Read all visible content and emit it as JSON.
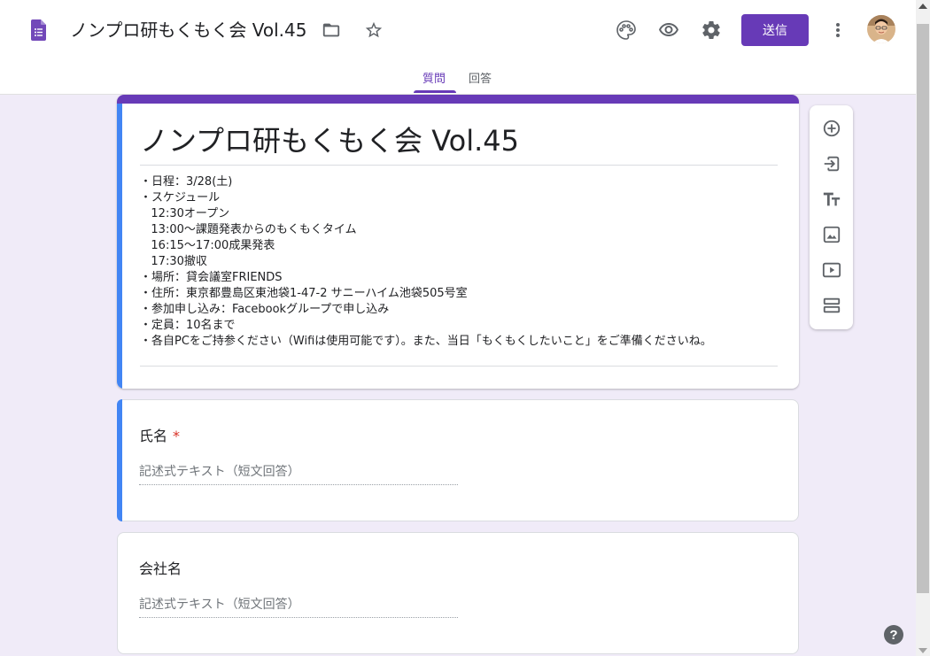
{
  "header": {
    "doc_title": "ノンプロ研もくもく会 Vol.45",
    "send_label": "送信",
    "icons": [
      "forms-logo-icon",
      "folder-icon",
      "star-icon",
      "palette-icon",
      "eye-preview-icon",
      "gear-icon",
      "more-vert-icon"
    ],
    "accent_color": "#673ab7"
  },
  "tabs": [
    {
      "label": "質問",
      "active": true
    },
    {
      "label": "回答",
      "active": false
    }
  ],
  "form": {
    "title": "ノンプロ研もくもく会 Vol.45",
    "description_lines": [
      "・日程：3/28(土)",
      "・スケジュール",
      "   12:30オープン",
      "   13:00～課題発表からのもくもくタイム",
      "   16:15～17:00成果発表",
      "   17:30撤収",
      "・場所：貸会議室FRIENDS",
      "・住所：東京都豊島区東池袋1-47-2 サニーハイム池袋505号室",
      "・参加申し込み：Facebookグループで申し込み",
      "・定員：10名まで",
      "・各自PCをご持参ください（Wifiは使用可能です）。また、当日「もくもくしたいこと」をご準備くださいね。"
    ]
  },
  "questions": [
    {
      "label": "氏名",
      "required": true,
      "required_mark": "*",
      "placeholder": "記述式テキスト（短文回答）",
      "active": true
    },
    {
      "label": "会社名",
      "required": false,
      "placeholder": "記述式テキスト（短文回答）",
      "active": false
    }
  ],
  "side_toolbar": [
    "add-question-icon",
    "import-questions-icon",
    "add-title-icon",
    "add-image-icon",
    "add-video-icon",
    "add-section-icon"
  ],
  "help_label": "?"
}
